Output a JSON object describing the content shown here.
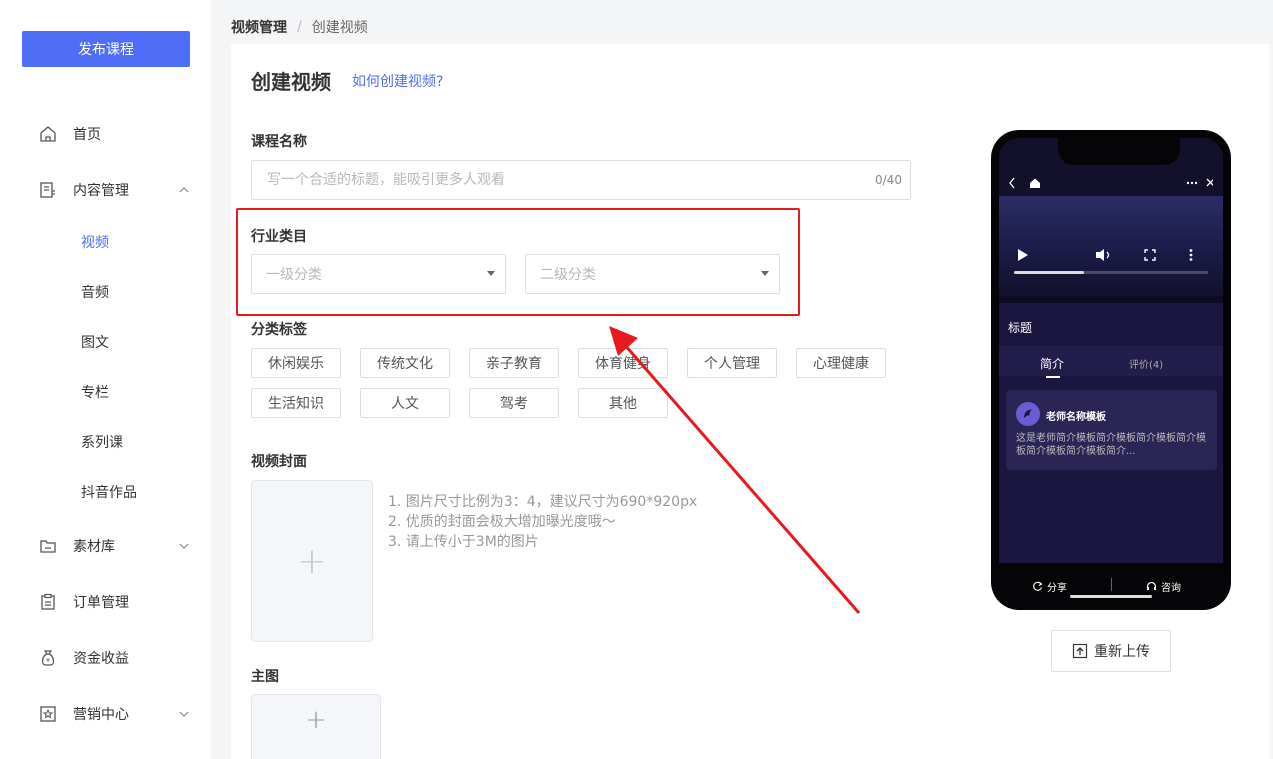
{
  "sidebar": {
    "publish_label": "发布课程",
    "items": [
      {
        "label": "首页",
        "icon": "home-icon"
      },
      {
        "label": "内容管理",
        "icon": "content-icon"
      },
      {
        "label": "素材库",
        "icon": "folder-icon"
      },
      {
        "label": "订单管理",
        "icon": "clipboard-icon"
      },
      {
        "label": "资金收益",
        "icon": "moneybag-icon"
      },
      {
        "label": "营销中心",
        "icon": "star-icon"
      }
    ],
    "sub_items": [
      "视频",
      "音频",
      "图文",
      "专栏",
      "系列课",
      "抖音作品"
    ],
    "active_sub": "视频"
  },
  "breadcrumb": {
    "parent": "视频管理",
    "separator": "/",
    "current": "创建视频"
  },
  "page": {
    "title": "创建视频",
    "help_link": "如何创建视频?"
  },
  "form": {
    "course_name_label": "课程名称",
    "course_name_placeholder": "写一个合适的标题，能吸引更多人观看",
    "course_name_value": "",
    "course_name_counter": "0/40",
    "industry_label": "行业类目",
    "primary_placeholder": "一级分类",
    "secondary_placeholder": "二级分类",
    "tags_label": "分类标签",
    "tags": [
      "休闲娱乐",
      "传统文化",
      "亲子教育",
      "体育健身",
      "个人管理",
      "心理健康",
      "生活知识",
      "人文",
      "驾考",
      "其他"
    ],
    "cover_label": "视频封面",
    "cover_hints": [
      "1. 图片尺寸比例为3：4，建议尺寸为690*920px",
      "2. 优质的封面会极大增加曝光度哦～",
      "3. 请上传小于3M的图片"
    ],
    "main_image_label": "主图"
  },
  "preview": {
    "title": "标题",
    "tab_intro": "简介",
    "tab_reviews": "评价(4)",
    "teacher_name": "老师名称模板",
    "teacher_desc": "这是老师简介模板简介模板简介模板简介模板简介模板简介模板简介...",
    "video_progress": 0.36,
    "share_label": "分享",
    "consult_label": "咨询",
    "reupload_label": "重新上传"
  },
  "colors": {
    "accent": "#4f6ef7",
    "highlight": "#e8191c"
  }
}
